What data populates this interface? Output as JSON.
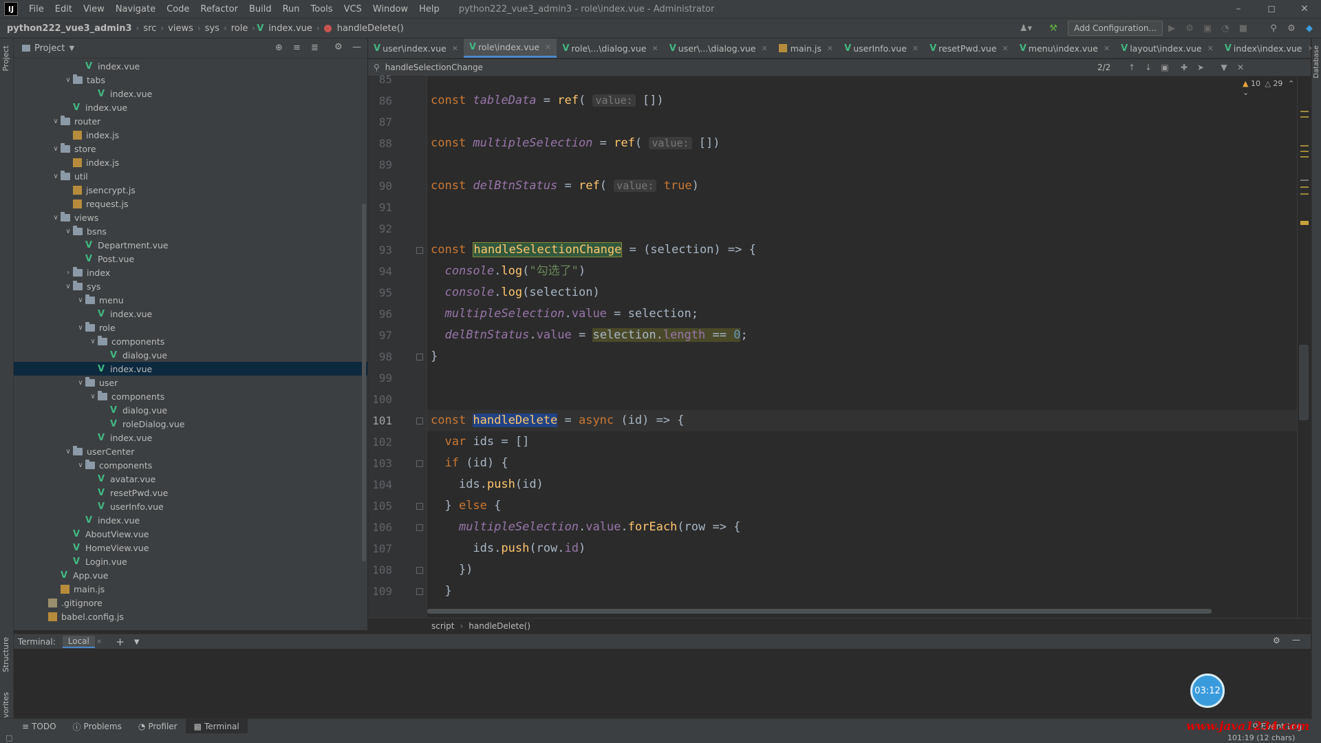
{
  "menubar": {
    "items": [
      "File",
      "Edit",
      "View",
      "Navigate",
      "Code",
      "Refactor",
      "Build",
      "Run",
      "Tools",
      "VCS",
      "Window",
      "Help"
    ],
    "window_title": "python222_vue3_admin3 - role\\index.vue - Administrator"
  },
  "navbar": {
    "project": "python222_vue3_admin3",
    "crumbs": [
      "src",
      "views",
      "sys",
      "role",
      "index.vue",
      "handleDelete()"
    ],
    "add_config": "Add Configuration..."
  },
  "project_panel": {
    "title": "Project",
    "tree": [
      {
        "indent": 5,
        "type": "vue",
        "label": "index.vue"
      },
      {
        "indent": 4,
        "type": "folder",
        "label": "tabs",
        "open": true
      },
      {
        "indent": 6,
        "type": "vue",
        "label": "index.vue"
      },
      {
        "indent": 4,
        "type": "vue",
        "label": "index.vue"
      },
      {
        "indent": 3,
        "type": "folder",
        "label": "router",
        "open": true
      },
      {
        "indent": 4,
        "type": "js",
        "label": "index.js"
      },
      {
        "indent": 3,
        "type": "folder",
        "label": "store",
        "open": true
      },
      {
        "indent": 4,
        "type": "js",
        "label": "index.js"
      },
      {
        "indent": 3,
        "type": "folder",
        "label": "util",
        "open": true
      },
      {
        "indent": 4,
        "type": "js",
        "label": "jsencrypt.js"
      },
      {
        "indent": 4,
        "type": "js",
        "label": "request.js"
      },
      {
        "indent": 3,
        "type": "folder",
        "label": "views",
        "open": true
      },
      {
        "indent": 4,
        "type": "folder",
        "label": "bsns",
        "open": true
      },
      {
        "indent": 5,
        "type": "vue",
        "label": "Department.vue"
      },
      {
        "indent": 5,
        "type": "vue",
        "label": "Post.vue"
      },
      {
        "indent": 4,
        "type": "folder",
        "label": "index",
        "open": false
      },
      {
        "indent": 4,
        "type": "folder",
        "label": "sys",
        "open": true
      },
      {
        "indent": 5,
        "type": "folder",
        "label": "menu",
        "open": true
      },
      {
        "indent": 6,
        "type": "vue",
        "label": "index.vue"
      },
      {
        "indent": 5,
        "type": "folder",
        "label": "role",
        "open": true
      },
      {
        "indent": 6,
        "type": "folder",
        "label": "components",
        "open": true
      },
      {
        "indent": 7,
        "type": "vue",
        "label": "dialog.vue"
      },
      {
        "indent": 6,
        "type": "vue",
        "label": "index.vue",
        "selected": true
      },
      {
        "indent": 5,
        "type": "folder",
        "label": "user",
        "open": true
      },
      {
        "indent": 6,
        "type": "folder",
        "label": "components",
        "open": true
      },
      {
        "indent": 7,
        "type": "vue",
        "label": "dialog.vue"
      },
      {
        "indent": 7,
        "type": "vue",
        "label": "roleDialog.vue"
      },
      {
        "indent": 6,
        "type": "vue",
        "label": "index.vue"
      },
      {
        "indent": 4,
        "type": "folder",
        "label": "userCenter",
        "open": true
      },
      {
        "indent": 5,
        "type": "folder",
        "label": "components",
        "open": true
      },
      {
        "indent": 6,
        "type": "vue",
        "label": "avatar.vue"
      },
      {
        "indent": 6,
        "type": "vue",
        "label": "resetPwd.vue"
      },
      {
        "indent": 6,
        "type": "vue",
        "label": "userInfo.vue"
      },
      {
        "indent": 5,
        "type": "vue",
        "label": "index.vue"
      },
      {
        "indent": 4,
        "type": "vue",
        "label": "AboutView.vue"
      },
      {
        "indent": 4,
        "type": "vue",
        "label": "HomeView.vue"
      },
      {
        "indent": 4,
        "type": "vue",
        "label": "Login.vue"
      },
      {
        "indent": 3,
        "type": "vue",
        "label": "App.vue"
      },
      {
        "indent": 3,
        "type": "js",
        "label": "main.js"
      },
      {
        "indent": 2,
        "type": "git",
        "label": ".gitignore"
      },
      {
        "indent": 2,
        "type": "js",
        "label": "babel.config.js"
      }
    ]
  },
  "tabs": [
    {
      "label": "user\\index.vue",
      "type": "vue"
    },
    {
      "label": "role\\index.vue",
      "type": "vue",
      "active": true
    },
    {
      "label": "role\\...\\dialog.vue",
      "type": "vue"
    },
    {
      "label": "user\\...\\dialog.vue",
      "type": "vue"
    },
    {
      "label": "main.js",
      "type": "js"
    },
    {
      "label": "userInfo.vue",
      "type": "vue"
    },
    {
      "label": "resetPwd.vue",
      "type": "vue"
    },
    {
      "label": "menu\\index.vue",
      "type": "vue"
    },
    {
      "label": "layout\\index.vue",
      "type": "vue"
    },
    {
      "label": "index\\index.vue",
      "type": "vue"
    }
  ],
  "search": {
    "query": "handleSelectionChange",
    "count": "2/2"
  },
  "inspections": {
    "warnings": "10",
    "weak": "29"
  },
  "editor": {
    "current_line": 101,
    "lines": [
      {
        "n": 85,
        "html": ""
      },
      {
        "n": 86,
        "html": "<span class='kw'>const </span><span class='iv'>tableData</span> = <span class='fn'>ref</span>( <span class='hint'>value:</span> [])"
      },
      {
        "n": 87,
        "html": ""
      },
      {
        "n": 88,
        "html": "<span class='kw'>const </span><span class='iv'>multipleSelection</span> = <span class='fn'>ref</span>( <span class='hint'>value:</span> [])"
      },
      {
        "n": 89,
        "html": ""
      },
      {
        "n": 90,
        "html": "<span class='kw'>const </span><span class='iv'>delBtnStatus</span> = <span class='fn'>ref</span>( <span class='hint'>value:</span> <span class='kw'>true</span>)"
      },
      {
        "n": 91,
        "html": ""
      },
      {
        "n": 92,
        "html": ""
      },
      {
        "n": 93,
        "html": "<span class='kw'>const </span><span class='fn hl1'>handleSelectionChange</span> = (selection) => {"
      },
      {
        "n": 94,
        "html": "  <span class='iv'>console</span>.<span class='fn'>log</span>(<span class='st'>\"勾选了\"</span>)"
      },
      {
        "n": 95,
        "html": "  <span class='iv'>console</span>.<span class='fn'>log</span>(selection)"
      },
      {
        "n": 96,
        "html": "  <span class='iv'>multipleSelection</span>.<span class='prop'>value</span> = selection;"
      },
      {
        "n": 97,
        "html": "  <span class='iv'>delBtnStatus</span>.<span class='prop'>value</span> = <span class='hl3'>selection.<span class='prop'>length</span> == <span class='nm'>0</span></span>;"
      },
      {
        "n": 98,
        "html": "}"
      },
      {
        "n": 99,
        "html": ""
      },
      {
        "n": 100,
        "html": ""
      },
      {
        "n": 101,
        "html": "<span class='kw'>const </span><span class='fn hl2'>handleDelete</span> = <span class='kw'>async</span> (id) => {"
      },
      {
        "n": 102,
        "html": "  <span class='kw'>var</span> ids = []"
      },
      {
        "n": 103,
        "html": "  <span class='kw'>if</span> (id) {"
      },
      {
        "n": 104,
        "html": "    ids.<span class='fn'>push</span>(id)"
      },
      {
        "n": 105,
        "html": "  } <span class='kw'>else</span> {"
      },
      {
        "n": 106,
        "html": "    <span class='iv'>multipleSelection</span>.<span class='prop'>value</span>.<span class='fn'>forEach</span>(row => {"
      },
      {
        "n": 107,
        "html": "      ids.<span class='fn'>push</span>(row.<span class='prop'>id</span>)"
      },
      {
        "n": 108,
        "html": "    })"
      },
      {
        "n": 109,
        "html": "  }"
      }
    ]
  },
  "editor_crumb": [
    "script",
    "handleDelete()"
  ],
  "terminal": {
    "label": "Terminal:",
    "tab": "Local"
  },
  "timer": "03:12",
  "bottom_tools": [
    "TODO",
    "Problems",
    "Profiler",
    "Terminal"
  ],
  "event_log": "Event Log",
  "status": {
    "position": "101:19 (12 chars)"
  },
  "watermark": "www.java1234.com",
  "side_labels": {
    "project": "Project",
    "structure": "Structure",
    "favorites": "Favorites",
    "database": "Database"
  }
}
